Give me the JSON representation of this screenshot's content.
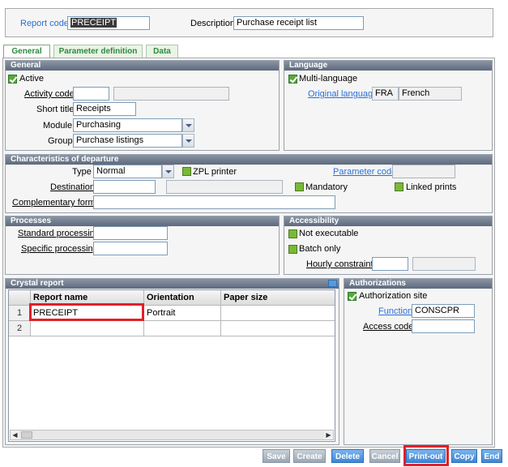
{
  "header": {
    "report_code_label": "Report code",
    "report_code_value": "PRECEIPT",
    "description_label": "Description",
    "description_value": "Purchase receipt list"
  },
  "tabs": [
    {
      "label": "General",
      "active": true
    },
    {
      "label": "Parameter definition",
      "active": false
    },
    {
      "label": "Data",
      "active": false
    }
  ],
  "general": {
    "title": "General",
    "active_label": "Active",
    "active_checked": true,
    "activity_code_label": "Activity code",
    "activity_code_value": "",
    "short_title_label": "Short title",
    "short_title_value": "Receipts",
    "module_label": "Module",
    "module_value": "Purchasing",
    "group_label": "Group",
    "group_value": "Purchase listings"
  },
  "language": {
    "title": "Language",
    "multi_label": "Multi-language",
    "multi_checked": true,
    "original_label": "Original language",
    "original_code": "FRA",
    "original_name": "French"
  },
  "departure": {
    "title": "Characteristics of departure",
    "type_label": "Type",
    "type_value": "Normal",
    "zpl_label": "ZPL printer",
    "param_code_label": "Parameter code",
    "param_code_value": "",
    "destination_label": "Destination",
    "destination_value": "",
    "mandatory_label": "Mandatory",
    "linked_label": "Linked prints",
    "comp_form_label": "Complementary form...",
    "comp_form_value": ""
  },
  "processes": {
    "title": "Processes",
    "standard_label": "Standard processing",
    "standard_value": "",
    "specific_label": "Specific processing",
    "specific_value": ""
  },
  "accessibility": {
    "title": "Accessibility",
    "not_exec_label": "Not executable",
    "batch_label": "Batch only",
    "hourly_label": "Hourly constraints"
  },
  "crystal": {
    "title": "Crystal report",
    "columns": [
      "Report name",
      "Orientation",
      "Paper size"
    ],
    "rows": [
      {
        "num": "1",
        "name": "PRECEIPT",
        "orientation": "Portrait",
        "paper": ""
      },
      {
        "num": "2",
        "name": "",
        "orientation": "",
        "paper": ""
      }
    ]
  },
  "authorizations": {
    "title": "Authorizations",
    "site_label": "Authorization site",
    "site_checked": true,
    "function_label": "Function",
    "function_value": "CONSCPR",
    "access_label": "Access code",
    "access_value": ""
  },
  "buttons": [
    {
      "label": "Save",
      "enabled": false
    },
    {
      "label": "Create",
      "enabled": false
    },
    {
      "label": "Delete",
      "enabled": true
    },
    {
      "label": "Cancel",
      "enabled": false
    },
    {
      "label": "Print-out",
      "enabled": true
    },
    {
      "label": "Copy",
      "enabled": true
    },
    {
      "label": "End",
      "enabled": true
    }
  ],
  "colors": {
    "link": "#2a6fd8",
    "highlight": "#e0202a",
    "tab_text": "#2e8a3e"
  }
}
